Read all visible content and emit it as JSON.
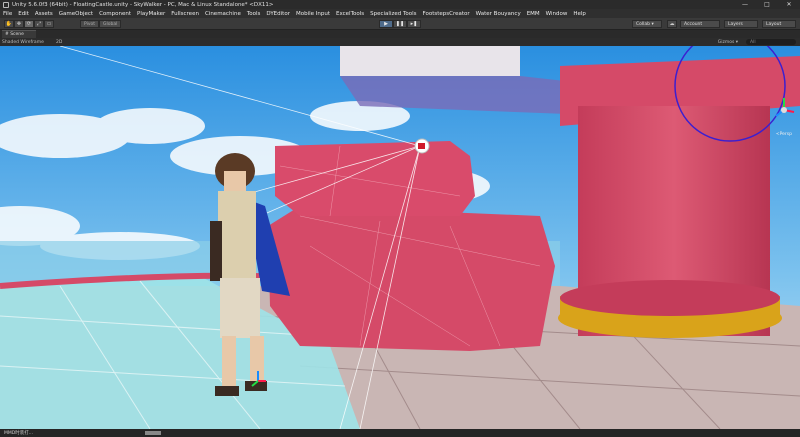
{
  "window": {
    "title": "Unity 5.6.0f3 (64bit) - FloatingCastle.unity - SkyWalker - PC, Mac & Linux Standalone* <DX11>",
    "controls": [
      "—",
      "□",
      "✕"
    ]
  },
  "menu": [
    "File",
    "Edit",
    "Assets",
    "GameObject",
    "Component",
    "PlayMaker",
    "Fullscreen",
    "Cinemachine",
    "Tools",
    "DYEditor",
    "Mobile Input",
    "ExcelTools",
    "Specialized Tools",
    "FootstepsCreator",
    "Water Bouyancy",
    "EMM",
    "Window",
    "Help"
  ],
  "toolbar": {
    "tools": [
      "✋",
      "✥",
      "⟳",
      "⤢",
      "▭"
    ],
    "pivot_label": "Pivot",
    "global_label": "Global",
    "play_icons": [
      "▶",
      "❚❚",
      "▸❚"
    ],
    "collab_label": "Collab ▾",
    "account_label": "Account",
    "layers_label": "Layers",
    "layout_label": "Layout"
  },
  "scene": {
    "tab_label": "# Scene",
    "shading_label": "Shaded Wireframe",
    "mode_label": "2D",
    "gizmos_label": "Gizmos ▾",
    "search_placeholder": "All",
    "persp_label": "<Persp"
  },
  "status": {
    "text": "MMD时装打..."
  },
  "colors": {
    "sky_top": "#2a8fe0",
    "sky_bottom": "#a9d6f2",
    "pink_block": "#d54a68",
    "glass_floor": "#9fe3e8",
    "stone_tile": "#c9b6b4",
    "gold_ring": "#d9a31a",
    "character_blue": "#1f3fb0",
    "play_accent": "#4f6b8a"
  }
}
